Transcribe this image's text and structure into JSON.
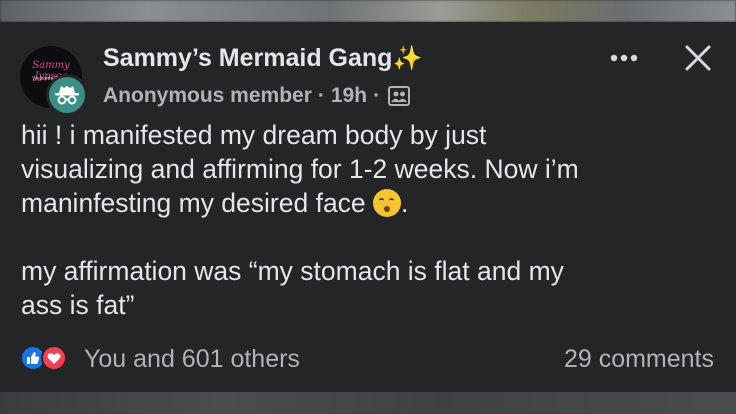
{
  "group": {
    "name": "Sammy’s Mermaid Gang",
    "name_emoji": "✨",
    "avatar_script": "Sammy Jypsea",
    "avatar_tagline": "Welcome To The"
  },
  "author": {
    "name": "Anonymous member",
    "time": "19h",
    "separator": "·",
    "privacy_icon": "group-privacy-icon"
  },
  "post": {
    "line1": "hii ! i manifested my dream body by just",
    "line2": "visualizing and affirming for 1-2 weeks. Now i’m",
    "line3_start": "maninfesting my desired face",
    "line3_end": ".",
    "line4": "my affirmation was “my stomach is flat and my",
    "line5": "ass is fat”"
  },
  "footer": {
    "reactions_text": "You and 601 others",
    "comments_text": "29 comments"
  },
  "colors": {
    "card_bg": "#242526",
    "text_primary": "#e4e6eb",
    "text_secondary": "#b0b3b8",
    "like_blue": "#1b74e4",
    "love_red": "#f33e58",
    "anon_teal": "#3a8f86"
  }
}
